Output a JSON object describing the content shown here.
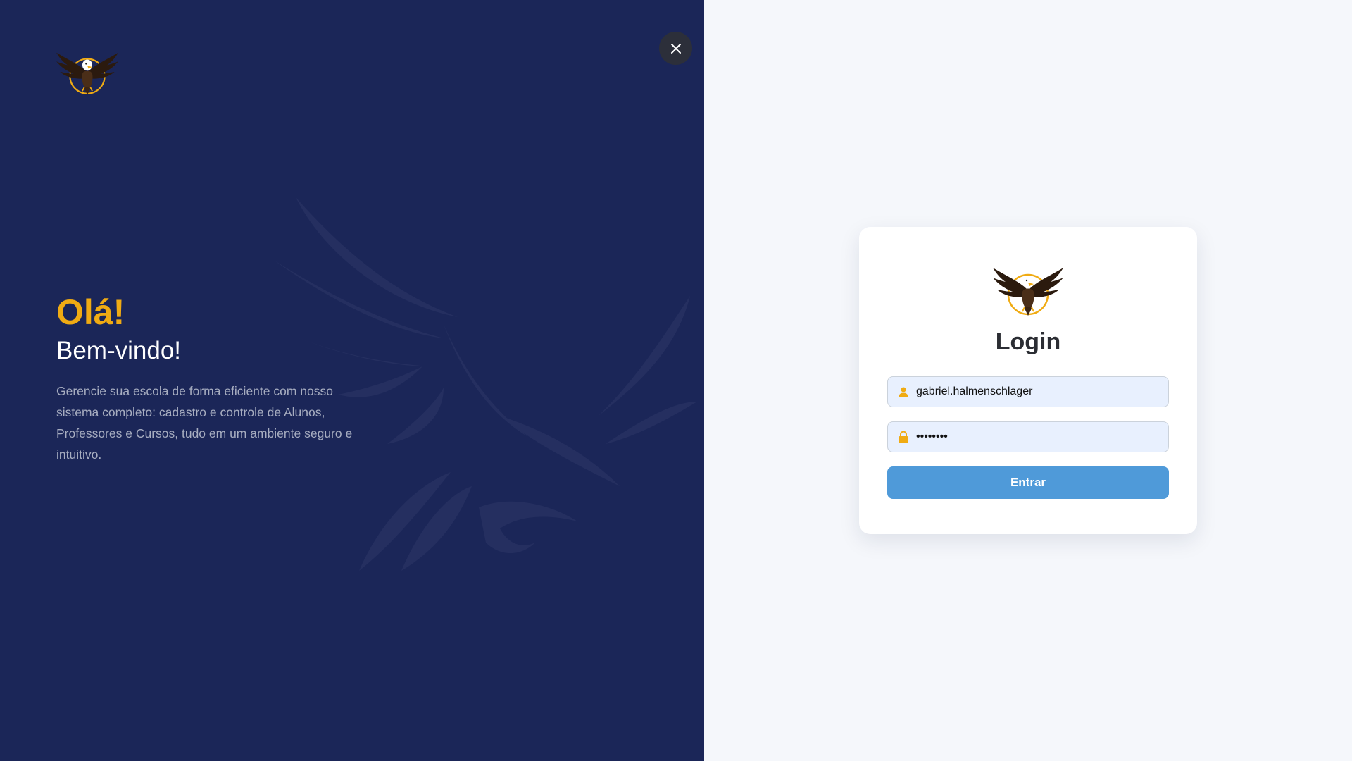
{
  "colors": {
    "left_panel_bg": "#1b2658",
    "accent": "#f0ab13",
    "right_bg": "#f5f7fb",
    "button_bg": "#4f9ad9",
    "input_bg": "#e8f0fe"
  },
  "icons": {
    "logo": "eagle-emblem-icon",
    "close": "close-icon",
    "user": "user-icon",
    "lock": "lock-icon",
    "background": "eagle-silhouette-icon"
  },
  "hero": {
    "greeting": "Olá!",
    "welcome": "Bem-vindo!",
    "description": "Gerencie sua escola de forma eficiente com nosso sistema completo: cadastro e controle de Alunos, Professores e Cursos, tudo em um ambiente seguro e intuitivo."
  },
  "login": {
    "title": "Login",
    "username_value": "gabriel.halmenschlager",
    "password_value": "12345678",
    "submit_label": "Entrar"
  }
}
